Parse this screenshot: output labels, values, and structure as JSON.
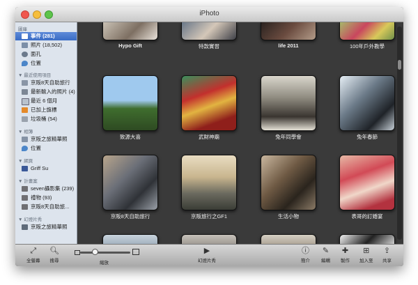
{
  "window": {
    "title": "iPhoto"
  },
  "sidebar": {
    "sections": [
      {
        "heading": "圖庫",
        "items": [
          {
            "label": "事件 (281)",
            "icon": "events-icon",
            "selected": true
          },
          {
            "label": "照片 (18,502)",
            "icon": "photos-icon"
          },
          {
            "label": "面孔",
            "icon": "faces-icon"
          },
          {
            "label": "位置",
            "icon": "places-icon"
          }
        ]
      },
      {
        "heading": "▼ 最近使用項目",
        "items": [
          {
            "label": "京阪8天自助旅行",
            "icon": "event-icon"
          },
          {
            "label": "最新輸入的照片 (4)",
            "icon": "import-icon"
          },
          {
            "label": "最近 6 個月",
            "icon": "calendar-icon"
          },
          {
            "label": "已加上旗標",
            "icon": "flag-icon"
          },
          {
            "label": "垃圾桶 (54)",
            "icon": "trash-icon"
          }
        ]
      },
      {
        "heading": "▼ 相簿",
        "items": [
          {
            "label": "京阪之旅精華照",
            "icon": "album-icon"
          },
          {
            "label": "位置",
            "icon": "places-icon"
          }
        ]
      },
      {
        "heading": "▼ 網頁",
        "items": [
          {
            "label": "Griff Su",
            "icon": "facebook-icon"
          }
        ]
      },
      {
        "heading": "▼ 計畫案",
        "items": [
          {
            "label": "seven攝影集 (239)",
            "icon": "book-icon"
          },
          {
            "label": "禮物 (93)",
            "icon": "book-icon"
          },
          {
            "label": "京阪8天自助旅...",
            "icon": "book-icon"
          }
        ]
      },
      {
        "heading": "▼ 幻燈片秀",
        "items": [
          {
            "label": "京阪之旅精華照",
            "icon": "slideshow-icon"
          }
        ]
      }
    ]
  },
  "events": [
    {
      "label": "Hypo Gift",
      "bold": true
    },
    {
      "label": "特款實習",
      "bold": false
    },
    {
      "label": "life 2011",
      "bold": true
    },
    {
      "label": "100年戶外教學",
      "bold": false
    },
    {
      "label": "致源大喜",
      "bold": false
    },
    {
      "label": "武財神廟",
      "bold": false
    },
    {
      "label": "兔年同學會",
      "bold": false
    },
    {
      "label": "兔年春節",
      "bold": false
    },
    {
      "label": "京阪8天自助旅行",
      "bold": false
    },
    {
      "label": "京阪旅行之GF1",
      "bold": false
    },
    {
      "label": "生活小物",
      "bold": false
    },
    {
      "label": "表哥的訂婚宴",
      "bold": false
    },
    {
      "label": "",
      "bold": false
    },
    {
      "label": "",
      "bold": false
    },
    {
      "label": "",
      "bold": false
    },
    {
      "label": "",
      "bold": false
    }
  ],
  "toolbar": {
    "fullscreen": "全螢幕",
    "search": "搜尋",
    "zoom": "縮放",
    "slideshow": "幻燈片秀",
    "info": "簡介",
    "edit": "編輯",
    "create": "製作",
    "add_to": "加入至",
    "share": "共享"
  },
  "colors": {
    "selection": "#3a6cc5",
    "content_bg": "#3a3a3a",
    "sidebar_bg": "#dde4ed"
  }
}
